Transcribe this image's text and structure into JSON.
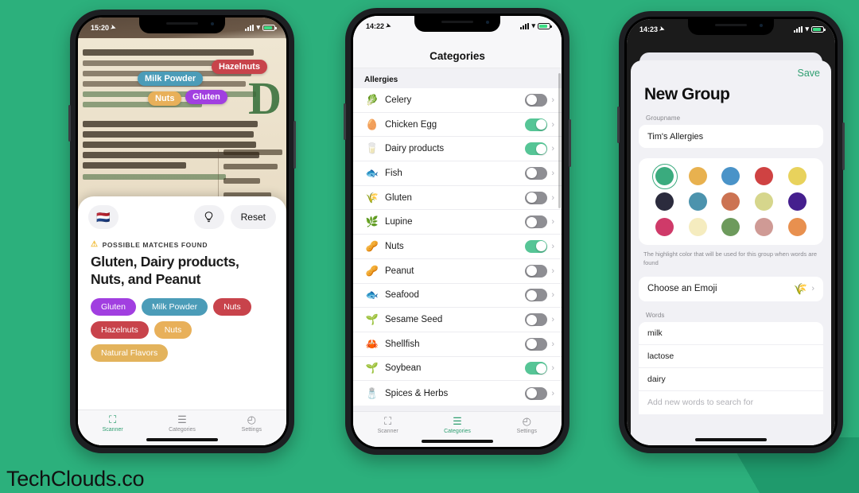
{
  "watermark": "TechClouds.co",
  "theme": {
    "background": "#2CB07C",
    "accent": "#2e9e70"
  },
  "phone1": {
    "status": {
      "time": "15:20",
      "location_icon": "location-arrow-icon"
    },
    "camera": {
      "brand_letter": "D",
      "overlay_tags": [
        {
          "label": "Hazelnuts",
          "color": "#c8434b"
        },
        {
          "label": "Milk Powder",
          "color": "#4b9cb8"
        },
        {
          "label": "Nuts",
          "color": "#e8b05a"
        },
        {
          "label": "Gluten",
          "color": "#a13fe0"
        }
      ]
    },
    "controls": {
      "flag_icon": "netherlands-flag-icon",
      "flag_glyph": "🇳🇱",
      "torch_icon": "lightbulb-icon",
      "reset_label": "Reset"
    },
    "result": {
      "status_text": "POSSIBLE MATCHES FOUND",
      "warning_icon": "warning-triangle-icon",
      "title": "Gluten, Dairy products, Nuts, and Peanut",
      "chips": [
        {
          "label": "Gluten",
          "color": "#a13fe0"
        },
        {
          "label": "Milk Powder",
          "color": "#4b9cb8"
        },
        {
          "label": "Nuts",
          "color": "#c8434b"
        },
        {
          "label": "Hazelnuts",
          "color": "#c8434b"
        },
        {
          "label": "Nuts",
          "color": "#e8b05a"
        },
        {
          "label": "Natural Flavors",
          "color": "#e3b35c"
        }
      ]
    },
    "tabs": [
      {
        "label": "Scanner",
        "icon": "scan-icon",
        "glyph": "⛶",
        "active": true
      },
      {
        "label": "Categories",
        "icon": "list-icon",
        "glyph": "☰",
        "active": false
      },
      {
        "label": "Settings",
        "icon": "gear-icon",
        "glyph": "◴",
        "active": false
      }
    ]
  },
  "phone2": {
    "status": {
      "time": "14:22",
      "location_icon": "location-arrow-icon"
    },
    "nav_title": "Categories",
    "section_header": "Allergies",
    "rows": [
      {
        "name": "Celery",
        "emoji": "🥬",
        "on": false
      },
      {
        "name": "Chicken Egg",
        "emoji": "🥚",
        "on": true
      },
      {
        "name": "Dairy products",
        "emoji": "🥛",
        "on": true
      },
      {
        "name": "Fish",
        "emoji": "🐟",
        "on": false
      },
      {
        "name": "Gluten",
        "emoji": "🌾",
        "on": false
      },
      {
        "name": "Lupine",
        "emoji": "🌿",
        "on": false
      },
      {
        "name": "Nuts",
        "emoji": "🥜",
        "on": true
      },
      {
        "name": "Peanut",
        "emoji": "🥜",
        "on": false
      },
      {
        "name": "Seafood",
        "emoji": "🐟",
        "on": false
      },
      {
        "name": "Sesame Seed",
        "emoji": "🌱",
        "on": false
      },
      {
        "name": "Shellfish",
        "emoji": "🦀",
        "on": false
      },
      {
        "name": "Soybean",
        "emoji": "🌱",
        "on": true
      },
      {
        "name": "Spices & Herbs",
        "emoji": "🧂",
        "on": false
      }
    ],
    "tabs": [
      {
        "label": "Scanner",
        "icon": "scan-icon",
        "glyph": "⛶",
        "active": false
      },
      {
        "label": "Categories",
        "icon": "list-icon",
        "glyph": "☰",
        "active": true
      },
      {
        "label": "Settings",
        "icon": "gear-icon",
        "glyph": "◴",
        "active": false
      }
    ]
  },
  "phone3": {
    "status": {
      "time": "14:23",
      "location_icon": "location-arrow-icon"
    },
    "save_label": "Save",
    "title": "New Group",
    "groupname_label": "Groupname",
    "groupname_value": "Tim's Allergies",
    "swatches": [
      {
        "color": "#3aab7e",
        "selected": true
      },
      {
        "color": "#e8b14f",
        "selected": false
      },
      {
        "color": "#4a93c8",
        "selected": false
      },
      {
        "color": "#cf4242",
        "selected": false
      },
      {
        "color": "#e8d25c",
        "selected": false
      },
      {
        "color": "#2b2b3d",
        "selected": false
      },
      {
        "color": "#4c93ad",
        "selected": false
      },
      {
        "color": "#cc7352",
        "selected": false
      },
      {
        "color": "#d6d68c",
        "selected": false
      },
      {
        "color": "#451f8e",
        "selected": false
      },
      {
        "color": "#cf3a69",
        "selected": false
      },
      {
        "color": "#f5ecbf",
        "selected": false
      },
      {
        "color": "#6d9a5c",
        "selected": false
      },
      {
        "color": "#cf9a95",
        "selected": false
      },
      {
        "color": "#e8904f",
        "selected": false
      }
    ],
    "swatch_helper": "The highlight color that will be used for this group when words are found",
    "emoji_row": {
      "label": "Choose an Emoji",
      "value": "🌾",
      "chevron_icon": "chevron-right-icon"
    },
    "words_label": "Words",
    "words": [
      "milk",
      "lactose",
      "dairy"
    ],
    "words_placeholder": "Add new words to search for"
  }
}
